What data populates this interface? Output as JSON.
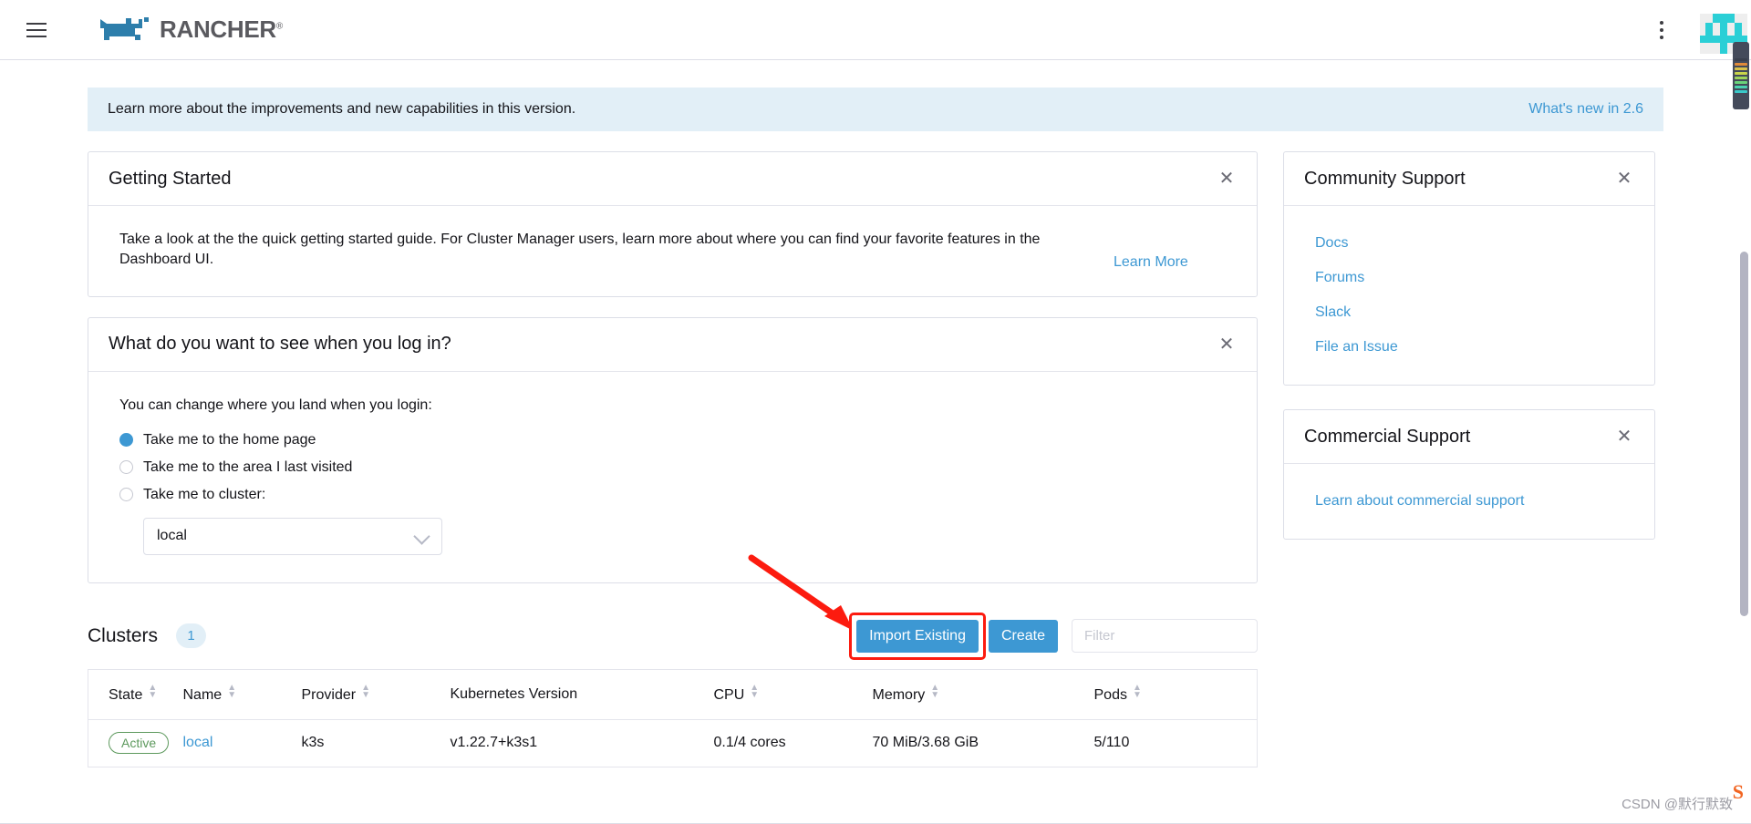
{
  "header": {
    "menu_icon": "hamburger-icon",
    "brand": "RANCHER",
    "brand_tm": "®",
    "kebab_icon": "vertical-dots-icon",
    "avatar_icon": "rancher-avatar-icon"
  },
  "banner": {
    "text": "Learn more about the improvements and new capabilities in this version.",
    "link": "What's new in 2.6"
  },
  "getting_started": {
    "title": "Getting Started",
    "close_icon": "close-icon",
    "body": "Take a look at the the quick getting started guide. For Cluster Manager users, learn more about where you can find your favorite features in the Dashboard UI.",
    "link": "Learn More"
  },
  "login_prefs": {
    "title": "What do you want to see when you log in?",
    "close_icon": "close-icon",
    "description": "You can change where you land when you login:",
    "options": [
      {
        "label": "Take me to the home page",
        "selected": true
      },
      {
        "label": "Take me to the area I last visited",
        "selected": false
      },
      {
        "label": "Take me to cluster:",
        "selected": false
      }
    ],
    "cluster_select_value": "local",
    "chevron_icon": "chevron-down-icon"
  },
  "clusters": {
    "title": "Clusters",
    "count": "1",
    "import_button": "Import Existing",
    "create_button": "Create",
    "filter_placeholder": "Filter",
    "columns": [
      {
        "label": "State",
        "sortable": true
      },
      {
        "label": "Name",
        "sortable": true
      },
      {
        "label": "Provider",
        "sortable": true
      },
      {
        "label": "Kubernetes Version",
        "sortable": false
      },
      {
        "label": "CPU",
        "sortable": true
      },
      {
        "label": "Memory",
        "sortable": true
      },
      {
        "label": "Pods",
        "sortable": true
      }
    ],
    "rows": [
      {
        "state": "Active",
        "name": "local",
        "provider": "k3s",
        "kubernetes_version": "v1.22.7+k3s1",
        "cpu": "0.1/4 cores",
        "memory": "70 MiB/3.68 GiB",
        "pods": "5/110"
      }
    ]
  },
  "community_support": {
    "title": "Community Support",
    "close_icon": "close-icon",
    "links": [
      "Docs",
      "Forums",
      "Slack",
      "File an Issue"
    ]
  },
  "commercial_support": {
    "title": "Commercial Support",
    "close_icon": "close-icon",
    "links": [
      "Learn about commercial support"
    ]
  },
  "annotation": {
    "arrow_color": "#fc1b0f",
    "highlight_target": "Import Existing"
  },
  "watermark": {
    "text": "CSDN @默行默致",
    "logo": "S"
  },
  "colors": {
    "accent": "#3d98d3",
    "banner_bg": "#e2eff7",
    "active_green": "#5d995d",
    "annotation_red": "#fc1b0f",
    "avatar_teal": "#2bcfd6"
  }
}
